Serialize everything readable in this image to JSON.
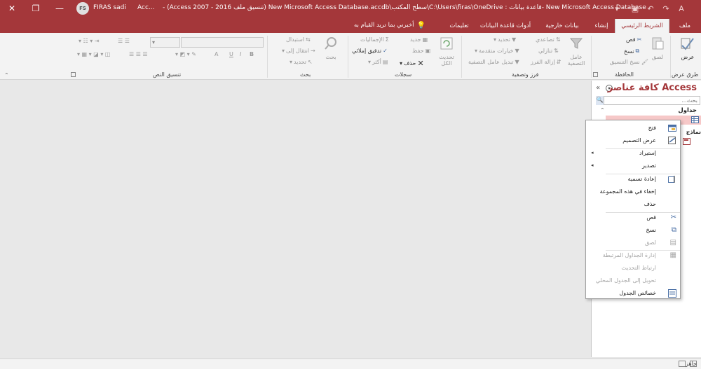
{
  "titlebar": {
    "user_initials": "FS",
    "user_name": "FIRAS sadi",
    "app_short": "Acc...",
    "window_title": "-  (Access 2007 - 2016 تنسيق ملف)  New Microsoft Access Database.accdb\\سطح المكتب\\C:\\Users\\firas\\OneDrive : قاعدة بيانات- New Microsoft Access Database",
    "close_glyph": "✕",
    "restore_glyph": "❐",
    "minimize_glyph": "—"
  },
  "tabs": {
    "file": "ملف",
    "home": "الشريط الرئيسي",
    "create": "إنشاء",
    "external": "بيانات خارجية",
    "dbtools": "أدوات قاعدة البيانات",
    "help": "تعليمات",
    "tell_me": "أخبرني بما تريد القيام به"
  },
  "ribbon": {
    "views": {
      "view": "عرض",
      "group": "طرق عرض"
    },
    "clipboard": {
      "paste": "لصق",
      "cut": "قص",
      "copy": "نسخ",
      "format_painter": "نسخ التنسيق",
      "group": "الحافظة"
    },
    "sort_filter": {
      "filter": "عامل التصفية",
      "ascending": "تصاعدي",
      "descending": "تنازلي",
      "remove_sort": "إزالة الفرز",
      "selection": "تحديد",
      "advanced": "خيارات متقدمة",
      "toggle_filter": "تبديل عامل التصفية",
      "group": "فرز وتصفية"
    },
    "records": {
      "refresh": "تحديث الكل",
      "new": "جديد",
      "save": "حفظ",
      "delete": "حذف",
      "totals": "الإجماليات",
      "spelling": "تدقيق إملائي",
      "more": "أكثر",
      "group": "سجلات"
    },
    "find": {
      "find": "بحث",
      "replace": "استبدال",
      "goto": "انتقال إلى",
      "select": "تحديد",
      "group": "بحث"
    },
    "text_format": {
      "group": "تنسيق النص",
      "bold": "B",
      "italic": "I",
      "underline": "U",
      "font_size_a": "A"
    }
  },
  "nav": {
    "title": "كافة عناصر Access",
    "search_placeholder": "بحث...",
    "section_tables": "جداول",
    "section_forms": "نماذج"
  },
  "context_menu": {
    "items": [
      {
        "label": "فتح",
        "enabled": true,
        "has_submenu": false,
        "icon": "open-icon"
      },
      {
        "label": "عرض التصميم",
        "enabled": true,
        "has_submenu": false,
        "icon": "design-view-icon"
      },
      {
        "label": "إستيراد",
        "enabled": true,
        "has_submenu": true,
        "icon": ""
      },
      {
        "label": "تصدير",
        "enabled": true,
        "has_submenu": true,
        "icon": ""
      },
      {
        "label": "إعادة تسمية",
        "enabled": true,
        "has_submenu": false,
        "icon": "rename-icon"
      },
      {
        "label": "إخفاء في هذه المجموعة",
        "enabled": true,
        "has_submenu": false,
        "icon": ""
      },
      {
        "label": "حذف",
        "enabled": true,
        "has_submenu": false,
        "icon": ""
      },
      {
        "label": "قص",
        "enabled": true,
        "has_submenu": false,
        "icon": "cut-icon"
      },
      {
        "label": "نسخ",
        "enabled": true,
        "has_submenu": false,
        "icon": "copy-icon"
      },
      {
        "label": "لصق",
        "enabled": false,
        "has_submenu": false,
        "icon": "paste-icon"
      },
      {
        "label": "إدارة الجداول المرتبطة",
        "enabled": false,
        "has_submenu": false,
        "icon": "linked-tables-icon"
      },
      {
        "label": "ارتباط التحديث",
        "enabled": false,
        "has_submenu": false,
        "icon": ""
      },
      {
        "label": "تحويل إلى الجدول المحلي",
        "enabled": false,
        "has_submenu": false,
        "icon": ""
      },
      {
        "label": "خصائص الجدول",
        "enabled": true,
        "has_submenu": false,
        "icon": "table-properties-icon"
      }
    ]
  },
  "status": {
    "text": "جاهز"
  },
  "colors": {
    "accent": "#a4373a",
    "selection": "#f6c8c8"
  }
}
